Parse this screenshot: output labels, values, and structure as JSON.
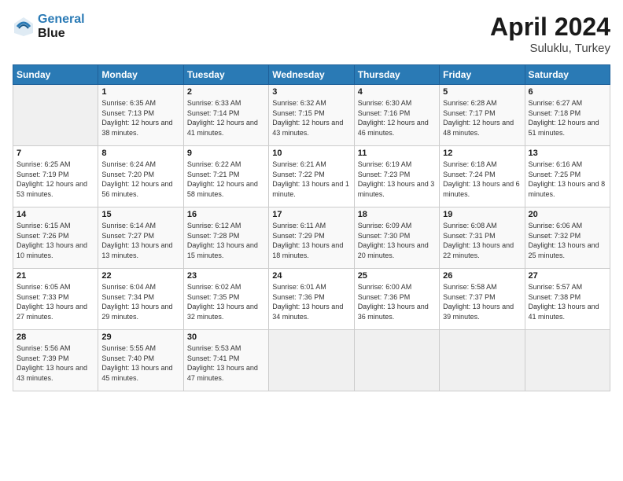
{
  "header": {
    "logo_line1": "General",
    "logo_line2": "Blue",
    "month": "April 2024",
    "location": "Suluklu, Turkey"
  },
  "weekdays": [
    "Sunday",
    "Monday",
    "Tuesday",
    "Wednesday",
    "Thursday",
    "Friday",
    "Saturday"
  ],
  "weeks": [
    [
      {
        "day": "",
        "sunrise": "",
        "sunset": "",
        "daylight": ""
      },
      {
        "day": "1",
        "sunrise": "Sunrise: 6:35 AM",
        "sunset": "Sunset: 7:13 PM",
        "daylight": "Daylight: 12 hours and 38 minutes."
      },
      {
        "day": "2",
        "sunrise": "Sunrise: 6:33 AM",
        "sunset": "Sunset: 7:14 PM",
        "daylight": "Daylight: 12 hours and 41 minutes."
      },
      {
        "day": "3",
        "sunrise": "Sunrise: 6:32 AM",
        "sunset": "Sunset: 7:15 PM",
        "daylight": "Daylight: 12 hours and 43 minutes."
      },
      {
        "day": "4",
        "sunrise": "Sunrise: 6:30 AM",
        "sunset": "Sunset: 7:16 PM",
        "daylight": "Daylight: 12 hours and 46 minutes."
      },
      {
        "day": "5",
        "sunrise": "Sunrise: 6:28 AM",
        "sunset": "Sunset: 7:17 PM",
        "daylight": "Daylight: 12 hours and 48 minutes."
      },
      {
        "day": "6",
        "sunrise": "Sunrise: 6:27 AM",
        "sunset": "Sunset: 7:18 PM",
        "daylight": "Daylight: 12 hours and 51 minutes."
      }
    ],
    [
      {
        "day": "7",
        "sunrise": "Sunrise: 6:25 AM",
        "sunset": "Sunset: 7:19 PM",
        "daylight": "Daylight: 12 hours and 53 minutes."
      },
      {
        "day": "8",
        "sunrise": "Sunrise: 6:24 AM",
        "sunset": "Sunset: 7:20 PM",
        "daylight": "Daylight: 12 hours and 56 minutes."
      },
      {
        "day": "9",
        "sunrise": "Sunrise: 6:22 AM",
        "sunset": "Sunset: 7:21 PM",
        "daylight": "Daylight: 12 hours and 58 minutes."
      },
      {
        "day": "10",
        "sunrise": "Sunrise: 6:21 AM",
        "sunset": "Sunset: 7:22 PM",
        "daylight": "Daylight: 13 hours and 1 minute."
      },
      {
        "day": "11",
        "sunrise": "Sunrise: 6:19 AM",
        "sunset": "Sunset: 7:23 PM",
        "daylight": "Daylight: 13 hours and 3 minutes."
      },
      {
        "day": "12",
        "sunrise": "Sunrise: 6:18 AM",
        "sunset": "Sunset: 7:24 PM",
        "daylight": "Daylight: 13 hours and 6 minutes."
      },
      {
        "day": "13",
        "sunrise": "Sunrise: 6:16 AM",
        "sunset": "Sunset: 7:25 PM",
        "daylight": "Daylight: 13 hours and 8 minutes."
      }
    ],
    [
      {
        "day": "14",
        "sunrise": "Sunrise: 6:15 AM",
        "sunset": "Sunset: 7:26 PM",
        "daylight": "Daylight: 13 hours and 10 minutes."
      },
      {
        "day": "15",
        "sunrise": "Sunrise: 6:14 AM",
        "sunset": "Sunset: 7:27 PM",
        "daylight": "Daylight: 13 hours and 13 minutes."
      },
      {
        "day": "16",
        "sunrise": "Sunrise: 6:12 AM",
        "sunset": "Sunset: 7:28 PM",
        "daylight": "Daylight: 13 hours and 15 minutes."
      },
      {
        "day": "17",
        "sunrise": "Sunrise: 6:11 AM",
        "sunset": "Sunset: 7:29 PM",
        "daylight": "Daylight: 13 hours and 18 minutes."
      },
      {
        "day": "18",
        "sunrise": "Sunrise: 6:09 AM",
        "sunset": "Sunset: 7:30 PM",
        "daylight": "Daylight: 13 hours and 20 minutes."
      },
      {
        "day": "19",
        "sunrise": "Sunrise: 6:08 AM",
        "sunset": "Sunset: 7:31 PM",
        "daylight": "Daylight: 13 hours and 22 minutes."
      },
      {
        "day": "20",
        "sunrise": "Sunrise: 6:06 AM",
        "sunset": "Sunset: 7:32 PM",
        "daylight": "Daylight: 13 hours and 25 minutes."
      }
    ],
    [
      {
        "day": "21",
        "sunrise": "Sunrise: 6:05 AM",
        "sunset": "Sunset: 7:33 PM",
        "daylight": "Daylight: 13 hours and 27 minutes."
      },
      {
        "day": "22",
        "sunrise": "Sunrise: 6:04 AM",
        "sunset": "Sunset: 7:34 PM",
        "daylight": "Daylight: 13 hours and 29 minutes."
      },
      {
        "day": "23",
        "sunrise": "Sunrise: 6:02 AM",
        "sunset": "Sunset: 7:35 PM",
        "daylight": "Daylight: 13 hours and 32 minutes."
      },
      {
        "day": "24",
        "sunrise": "Sunrise: 6:01 AM",
        "sunset": "Sunset: 7:36 PM",
        "daylight": "Daylight: 13 hours and 34 minutes."
      },
      {
        "day": "25",
        "sunrise": "Sunrise: 6:00 AM",
        "sunset": "Sunset: 7:36 PM",
        "daylight": "Daylight: 13 hours and 36 minutes."
      },
      {
        "day": "26",
        "sunrise": "Sunrise: 5:58 AM",
        "sunset": "Sunset: 7:37 PM",
        "daylight": "Daylight: 13 hours and 39 minutes."
      },
      {
        "day": "27",
        "sunrise": "Sunrise: 5:57 AM",
        "sunset": "Sunset: 7:38 PM",
        "daylight": "Daylight: 13 hours and 41 minutes."
      }
    ],
    [
      {
        "day": "28",
        "sunrise": "Sunrise: 5:56 AM",
        "sunset": "Sunset: 7:39 PM",
        "daylight": "Daylight: 13 hours and 43 minutes."
      },
      {
        "day": "29",
        "sunrise": "Sunrise: 5:55 AM",
        "sunset": "Sunset: 7:40 PM",
        "daylight": "Daylight: 13 hours and 45 minutes."
      },
      {
        "day": "30",
        "sunrise": "Sunrise: 5:53 AM",
        "sunset": "Sunset: 7:41 PM",
        "daylight": "Daylight: 13 hours and 47 minutes."
      },
      {
        "day": "",
        "sunrise": "",
        "sunset": "",
        "daylight": ""
      },
      {
        "day": "",
        "sunrise": "",
        "sunset": "",
        "daylight": ""
      },
      {
        "day": "",
        "sunrise": "",
        "sunset": "",
        "daylight": ""
      },
      {
        "day": "",
        "sunrise": "",
        "sunset": "",
        "daylight": ""
      }
    ]
  ]
}
